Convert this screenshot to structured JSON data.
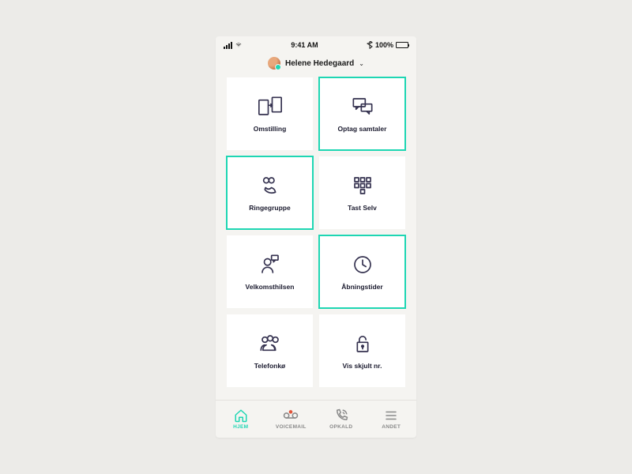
{
  "status_bar": {
    "time": "9:41 AM",
    "battery_text": "100%"
  },
  "user": {
    "name": "Helene Hedegaard"
  },
  "tiles": [
    {
      "id": "omstilling",
      "label": "Omstilling",
      "selected": false
    },
    {
      "id": "optag",
      "label": "Optag samtaler",
      "selected": true
    },
    {
      "id": "ringegruppe",
      "label": "Ringegruppe",
      "selected": true
    },
    {
      "id": "tastselv",
      "label": "Tast Selv",
      "selected": false
    },
    {
      "id": "velkomst",
      "label": "Velkomsthilsen",
      "selected": false
    },
    {
      "id": "abning",
      "label": "Åbningstider",
      "selected": true
    },
    {
      "id": "telefonko",
      "label": "Telefonkø",
      "selected": false
    },
    {
      "id": "visskjult",
      "label": "Vis skjult nr.",
      "selected": false
    }
  ],
  "tabs": [
    {
      "id": "hjem",
      "label": "HJEM",
      "active": true
    },
    {
      "id": "voicemail",
      "label": "VOICEMAIL",
      "active": false
    },
    {
      "id": "opkald",
      "label": "OPKALD",
      "active": false
    },
    {
      "id": "andet",
      "label": "ANDET",
      "active": false
    }
  ],
  "colors": {
    "accent": "#1ed6b3",
    "icon": "#34314f"
  }
}
